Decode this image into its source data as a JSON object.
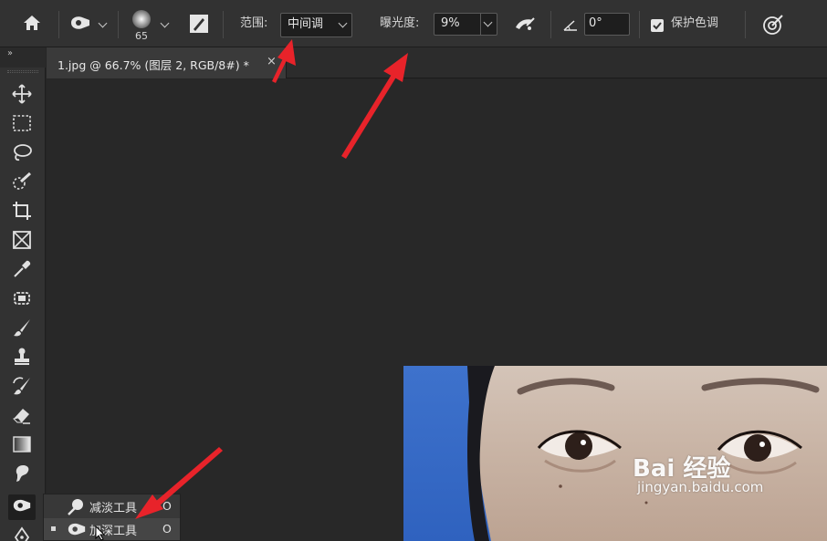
{
  "options_bar": {
    "brush_size": "65",
    "range_label": "范围:",
    "range_value": "中间调",
    "exposure_label": "曝光度:",
    "exposure_value": "9%",
    "angle_value": "0°",
    "protect_tones_label": "保护色调",
    "protect_tones_checked": true
  },
  "document_tab": {
    "title": "1.jpg @ 66.7% (图层 2, RGB/8#) *",
    "close": "×"
  },
  "toolbar": {
    "collapse": "››",
    "tools": [
      "move-tool",
      "marquee-tool",
      "lasso-tool",
      "quick-select-tool",
      "crop-tool",
      "frame-tool",
      "eyedropper-tool",
      "spot-healing-tool",
      "brush-tool",
      "clone-stamp-tool",
      "history-brush-tool",
      "eraser-tool",
      "gradient-tool",
      "blur-tool",
      "burn-tool",
      "pen-tool"
    ]
  },
  "flyout": {
    "items": [
      {
        "label": "减淡工具",
        "shortcut": "O",
        "selected": false
      },
      {
        "label": "加深工具",
        "shortcut": "O",
        "selected": true
      }
    ]
  },
  "watermark": {
    "main": "Bai 经验",
    "sub": "jingyan.baidu.com"
  },
  "colors": {
    "annotation_arrow": "#e8232a",
    "panel_bg": "#323232",
    "canvas_bg": "#282828"
  }
}
